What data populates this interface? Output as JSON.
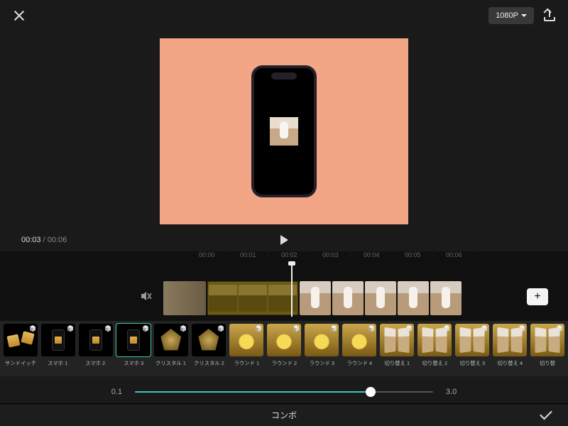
{
  "topbar": {
    "resolution": "1080P"
  },
  "time": {
    "current": "00:03",
    "total": "00:06"
  },
  "ruler": [
    "00:00",
    "00:01",
    "00:02",
    "00:03",
    "00:04",
    "00:05",
    "00:06"
  ],
  "effects": [
    {
      "label": "サンドイッチ",
      "variant": "sand"
    },
    {
      "label": "スマホ 1",
      "variant": "phone"
    },
    {
      "label": "スマホ 2",
      "variant": "phone"
    },
    {
      "label": "スマホ 3",
      "variant": "phone",
      "selected": true
    },
    {
      "label": "クリスタル 1",
      "variant": "crystal"
    },
    {
      "label": "クリスタル 2",
      "variant": "crystal"
    },
    {
      "label": "ラウンド 1",
      "variant": "round"
    },
    {
      "label": "ラウンド 2",
      "variant": "round alt"
    },
    {
      "label": "ラウンド 3",
      "variant": "round"
    },
    {
      "label": "ラウンド 4",
      "variant": "round alt"
    },
    {
      "label": "切り替え 1",
      "variant": "switch"
    },
    {
      "label": "切り替え 2",
      "variant": "switch"
    },
    {
      "label": "切り替え 3",
      "variant": "switch"
    },
    {
      "label": "切り替え 4",
      "variant": "switch"
    },
    {
      "label": "切り替",
      "variant": "switch"
    }
  ],
  "slider": {
    "min": "0.1",
    "max": "3.0"
  },
  "bottom": {
    "title": "コンボ"
  }
}
